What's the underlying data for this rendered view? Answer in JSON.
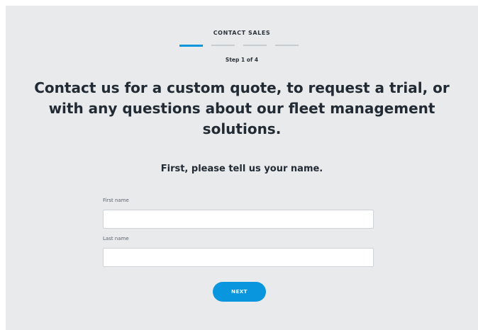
{
  "header": {
    "eyebrow": "CONTACT SALES",
    "step_text": "Step 1 of 4",
    "progress": {
      "current_step": 1,
      "total_steps": 4,
      "active_color": "#0a96de",
      "inactive_color": "#c7ccd1"
    }
  },
  "main": {
    "headline_line1": "Contact us for a custom quote, to request a trial, or",
    "headline_line2": "with any questions about our fleet management",
    "headline_line3": "solutions.",
    "subheading": "First, please tell us your name."
  },
  "form": {
    "first_name_label": "First name",
    "first_name_value": "",
    "last_name_label": "Last name",
    "last_name_value": "",
    "next_label": "NEXT"
  },
  "colors": {
    "panel_background": "#e9eaeb",
    "accent": "#0a96de"
  }
}
